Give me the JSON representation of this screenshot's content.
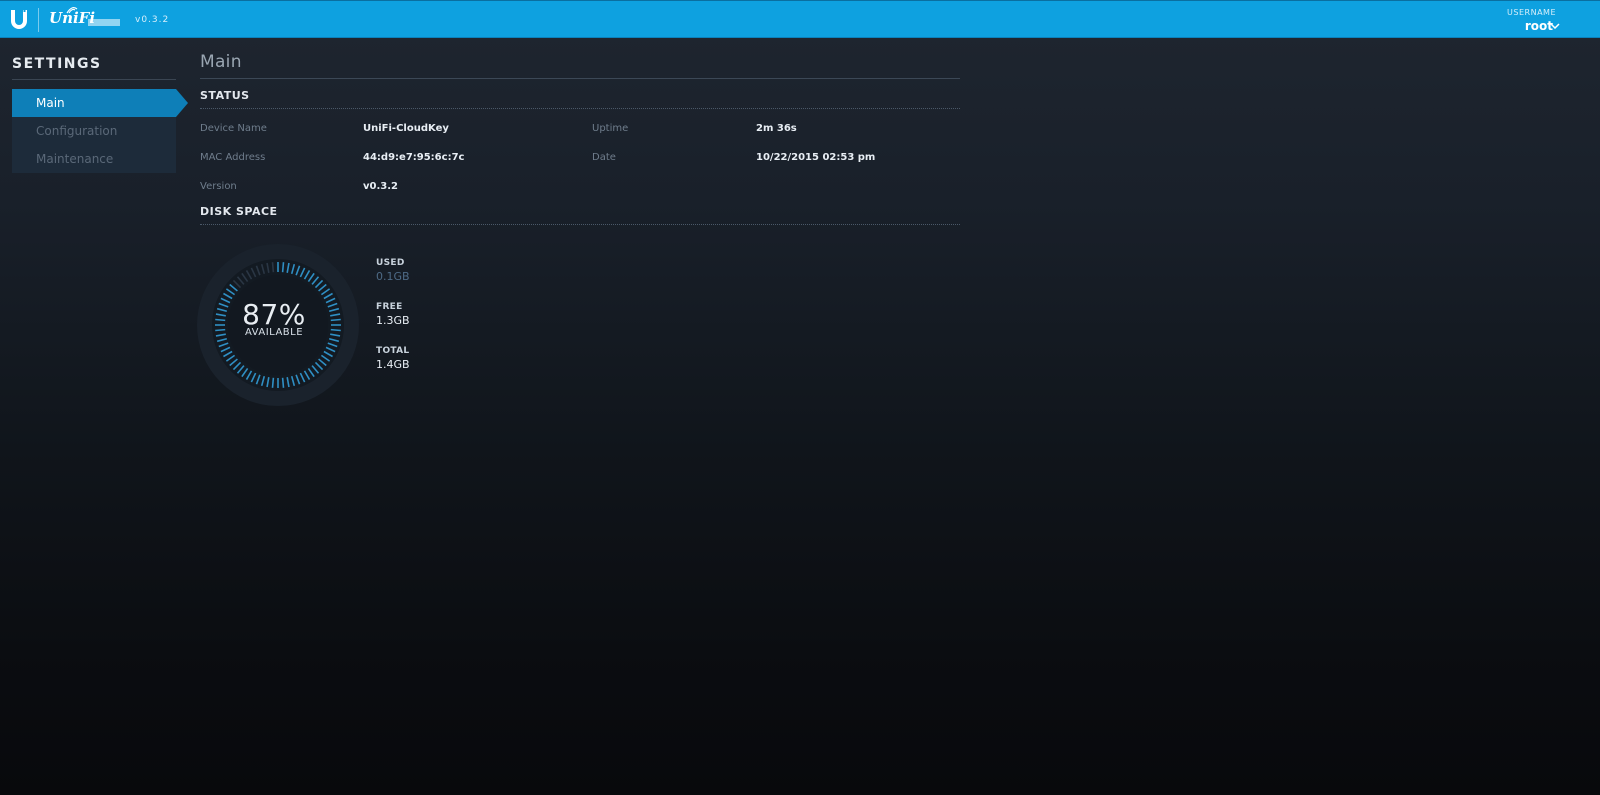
{
  "header": {
    "app_name": "UniFi",
    "version": "v0.3.2",
    "user_label": "USERNAME",
    "user_value": "root"
  },
  "sidebar": {
    "title": "SETTINGS",
    "items": [
      {
        "label": "Main",
        "active": true
      },
      {
        "label": "Configuration",
        "active": false
      },
      {
        "label": "Maintenance",
        "active": false
      }
    ]
  },
  "main": {
    "title": "Main",
    "status": {
      "section_title": "STATUS",
      "device_name_label": "Device Name",
      "device_name_value": "UniFi-CloudKey",
      "mac_label": "MAC Address",
      "mac_value": "44:d9:e7:95:6c:7c",
      "version_label": "Version",
      "version_value": "v0.3.2",
      "uptime_label": "Uptime",
      "uptime_value": "2m 36s",
      "date_label": "Date",
      "date_value": "10/22/2015 02:53 pm"
    },
    "disk": {
      "section_title": "DISK SPACE",
      "available_percent": "87%",
      "available_label": "AVAILABLE",
      "available_fraction": 0.87,
      "used_label": "USED",
      "used_value": "0.1GB",
      "free_label": "FREE",
      "free_value": "1.3GB",
      "total_label": "TOTAL",
      "total_value": "1.4GB"
    }
  },
  "colors": {
    "topbar": "#0ea1e0",
    "accent": "#0e7fb8",
    "gauge_tick": "#2f8fc4"
  },
  "icons": {
    "logo": "ubiquiti-u-icon",
    "user_menu": "chevron-down-icon"
  }
}
